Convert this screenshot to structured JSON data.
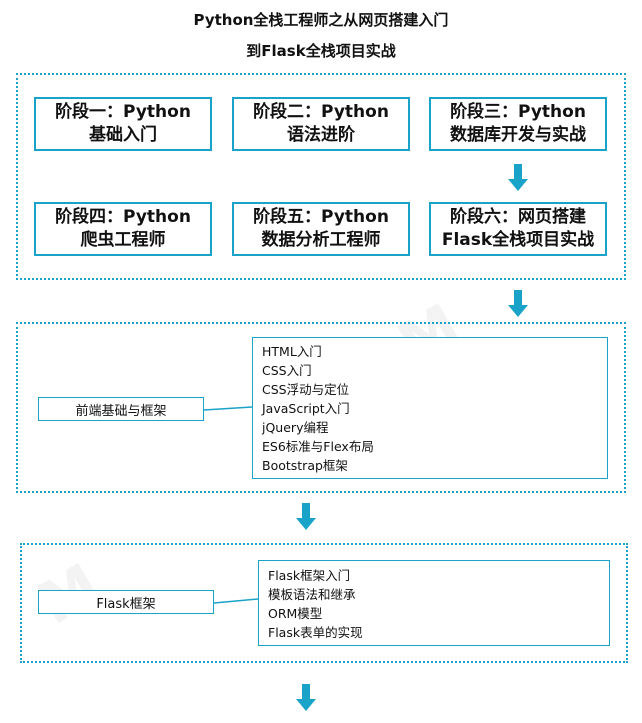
{
  "title": {
    "line1": "Python全栈工程师之从网页搭建入门",
    "line2": "到Flask全栈项目实战"
  },
  "stages": [
    {
      "line1": "阶段一：Python",
      "line2": "基础入门"
    },
    {
      "line1": "阶段二：Python",
      "line2": "语法进阶"
    },
    {
      "line1": "阶段三：Python",
      "line2": "数据库开发与实战"
    },
    {
      "line1": "阶段四：Python",
      "line2": "爬虫工程师"
    },
    {
      "line1": "阶段五：Python",
      "line2": "数据分析工程师"
    },
    {
      "line1": "阶段六：网页搭建",
      "line2": "Flask全栈项目实战"
    }
  ],
  "frontend": {
    "label": "前端基础与框架",
    "items": [
      "HTML入门",
      "CSS入门",
      "CSS浮动与定位",
      "JavaScript入门",
      "jQuery编程",
      "ES6标准与Flex布局",
      "Bootstrap框架"
    ]
  },
  "flask": {
    "label": "Flask框架",
    "items": [
      "Flask框架入门",
      "模板语法和继承",
      "ORM模型",
      "Flask表单的实现"
    ]
  },
  "colors": {
    "accent": "#1aa3c8",
    "text": "#111111"
  }
}
